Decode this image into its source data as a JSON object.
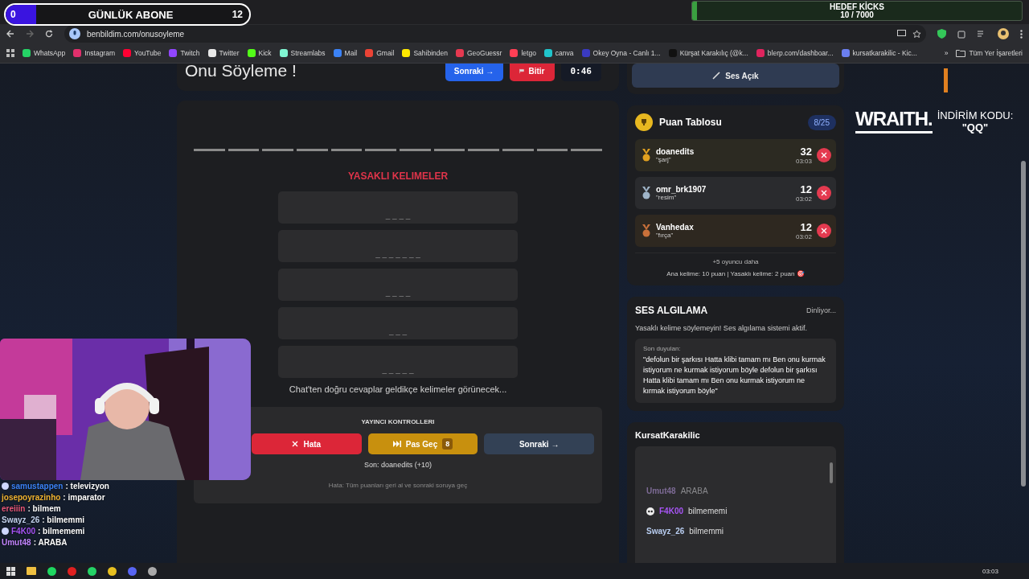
{
  "overlay": {
    "subscriber_goal": {
      "count": "0",
      "label": "GÜNLÜK ABONE",
      "target": "12"
    },
    "kick_goal": {
      "label": "HEDEF KİCKS",
      "progress": "10 / 7000",
      "level": 0.0014
    },
    "sponsor": {
      "brand": "WRAITH.",
      "code_label": "İNDİRİM KODU:",
      "code": "\"QQ\""
    },
    "chat": [
      {
        "user": "samustappen",
        "message": ": televizyon",
        "color": "#3b82f6",
        "badge": true
      },
      {
        "user": "josepoyrazinho",
        "message": ": imparator",
        "color": "#f0b432",
        "badge": false
      },
      {
        "user": "ereiiin",
        "message": ": bilmem",
        "color": "#e8587a",
        "badge": false
      },
      {
        "user": "Swayz_26",
        "message": ": bilmemmi",
        "color": "#c4d4f0",
        "badge": false
      },
      {
        "user": "F4K00",
        "message": ": bilmememi",
        "color": "#a855f7",
        "badge": true
      },
      {
        "user": "Umut48",
        "message": ": ARABA",
        "color": "#c084fc",
        "badge": false
      }
    ]
  },
  "browser": {
    "url": "benbildim.com/onusoyleme",
    "bookmarks": [
      {
        "label": "WhatsApp",
        "color": "#25d366"
      },
      {
        "label": "Instagram",
        "color": "#e1306c"
      },
      {
        "label": "YouTube",
        "color": "#ff0033"
      },
      {
        "label": "Twitch",
        "color": "#9146ff"
      },
      {
        "label": "Twitter",
        "color": "#e8e8e8"
      },
      {
        "label": "Kick",
        "color": "#53fc18"
      },
      {
        "label": "Streamlabs",
        "color": "#80f5d2"
      },
      {
        "label": "Mail",
        "color": "#3b82f6"
      },
      {
        "label": "Gmail",
        "color": "#ea4335"
      },
      {
        "label": "Sahibinden",
        "color": "#ffe800"
      },
      {
        "label": "GeoGuessr",
        "color": "#e53950"
      },
      {
        "label": "letgo",
        "color": "#ff3f55"
      },
      {
        "label": "canva",
        "color": "#20c4cb"
      },
      {
        "label": "Okey Oyna - Canlı 1...",
        "color": "#3a3ac0"
      },
      {
        "label": "Kürşat Karakılıç (@k...",
        "color": "#111111"
      },
      {
        "label": "blerp.com/dashboar...",
        "color": "#e0245e"
      },
      {
        "label": "kursatkarakilic - Kic...",
        "color": "#6b7ff0"
      }
    ],
    "more": "»",
    "all_bookmarks": "Tüm Yer İşaretleri"
  },
  "game": {
    "title": "Onu Söyleme !",
    "next_button": "Sonraki →",
    "finish_button": "Bitir",
    "timer": "0:46",
    "answer_slots": [
      {
        "revealed": false
      },
      {
        "revealed": false
      },
      {
        "revealed": false
      },
      {
        "revealed": false
      },
      {
        "revealed": false
      },
      {
        "revealed": false
      },
      {
        "revealed": false
      },
      {
        "revealed": false
      },
      {
        "revealed": false
      },
      {
        "revealed": false
      },
      {
        "revealed": false
      },
      {
        "revealed": false
      }
    ],
    "forbidden_title": "YASAKLI KELIMELER",
    "forbidden_words": [
      "_ _ _ _",
      "_ _ _ _ _ _ _",
      "_ _ _ _",
      "_ _ _",
      "_ _ _ _ _"
    ],
    "hint": "Chat'ten doğru cevaplar geldikçe kelimeler görünecek...",
    "controls": {
      "title": "YAYINCI KONTROLLERI",
      "error_button": "Hata",
      "skip_button": "Pas Geç",
      "skip_count": "8",
      "next_button": "Sonraki →",
      "last": "Son: doanedits (+10)",
      "note": "Hata: Tüm puanları geri al ve sonraki soruya geç"
    }
  },
  "sound": {
    "button": "Ses Açık"
  },
  "leaderboard": {
    "title": "Puan Tablosu",
    "count": "8/25",
    "rows": [
      {
        "name": "doanedits",
        "word": "\"şarj\"",
        "score": "32",
        "time": "03:03",
        "color": "#e0a020"
      },
      {
        "name": "omr_brk1907",
        "word": "\"resim\"",
        "score": "12",
        "time": "03:02",
        "color": "#9fb4c8"
      },
      {
        "name": "Vanhedax",
        "word": "\"fırça\"",
        "score": "12",
        "time": "03:02",
        "color": "#c8703a"
      }
    ],
    "more": "+5 oyuncu daha",
    "rules": "Ana kelime: 10 puan | Yasaklı kelime: 2 puan 🎯"
  },
  "voice": {
    "title": "SES ALGILAMA",
    "status": "Dinliyor...",
    "warning": "Yasaklı kelime söylemeyin! Ses algılama sistemi aktif.",
    "last_label": "Son duyulan:",
    "last_text": "\"defolun bir şarkısı Hatta klibi tamam mı Ben onu kurmak istiyorum ne kurmak istiyorum böyle defolun bir şarkısı Hatta klibi tamam mı Ben onu kurmak istiyorum ne kırmak istiyorum böyle\""
  },
  "stream_chat": {
    "title": "KursatKarakilic",
    "messages": [
      {
        "user": "Umut48",
        "message": "ARABA",
        "faded": true,
        "badge": false,
        "color": "#7c6a94"
      },
      {
        "user": "F4K00",
        "message": "bilmememi",
        "faded": false,
        "badge": true,
        "color": "#a855f7"
      },
      {
        "user": "Swayz_26",
        "message": "bilmemmi",
        "faded": false,
        "badge": false,
        "color": "#b8cdf0"
      }
    ]
  },
  "taskbar": {
    "clock": "03:03"
  }
}
